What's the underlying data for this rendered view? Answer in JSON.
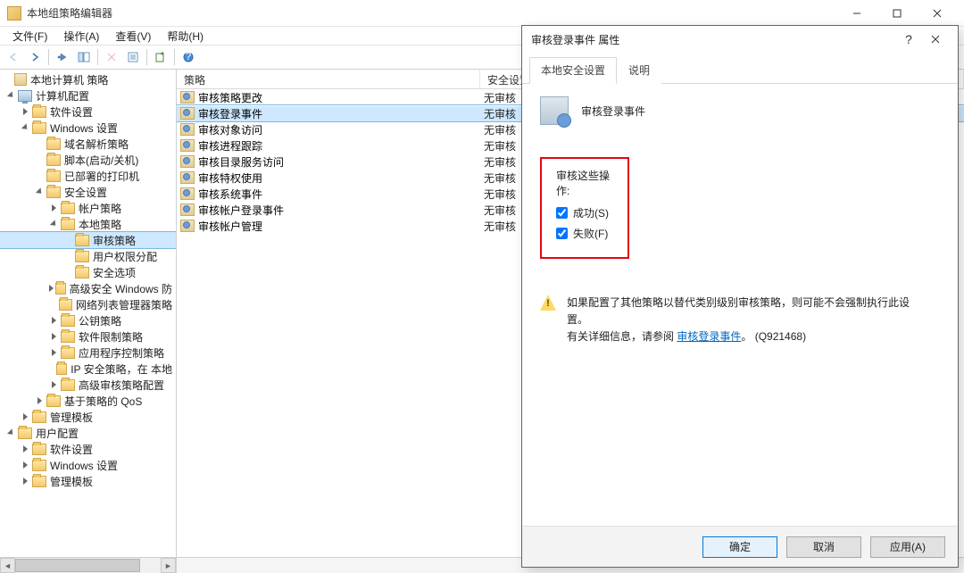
{
  "window": {
    "title": "本地组策略编辑器",
    "min_tip": "最小化",
    "max_tip": "最大化",
    "close_tip": "关闭"
  },
  "menu": {
    "file": "文件(F)",
    "action": "操作(A)",
    "view": "查看(V)",
    "help": "帮助(H)"
  },
  "tree": {
    "root": "本地计算机 策略",
    "computer_cfg": "计算机配置",
    "software_settings": "软件设置",
    "windows_settings": "Windows 设置",
    "dns_policy": "域名解析策略",
    "scripts": "脚本(启动/关机)",
    "deployed_printers": "已部署的打印机",
    "security_settings": "安全设置",
    "account_policy": "帐户策略",
    "local_policy": "本地策略",
    "audit_policy": "审核策略",
    "user_rights": "用户权限分配",
    "security_options": "安全选项",
    "adv_firewall": "高级安全 Windows 防",
    "net_list_mgr": "网络列表管理器策略",
    "pubkey_policy": "公钥策略",
    "software_restrict": "软件限制策略",
    "appctrl_policy": "应用程序控制策略",
    "ipsec_policy": "IP 安全策略，在 本地",
    "adv_audit_cfg": "高级审核策略配置",
    "qos": "基于策略的 QoS",
    "admin_templates_1": "管理模板",
    "user_cfg": "用户配置",
    "software_settings_2": "软件设置",
    "windows_settings_2": "Windows 设置",
    "admin_templates_2": "管理模板"
  },
  "list": {
    "col_policy": "策略",
    "col_setting": "安全设置",
    "rows": [
      {
        "name": "审核策略更改",
        "setting": "无审核"
      },
      {
        "name": "审核登录事件",
        "setting": "无审核"
      },
      {
        "name": "审核对象访问",
        "setting": "无审核"
      },
      {
        "name": "审核进程跟踪",
        "setting": "无审核"
      },
      {
        "name": "审核目录服务访问",
        "setting": "无审核"
      },
      {
        "name": "审核特权使用",
        "setting": "无审核"
      },
      {
        "name": "审核系统事件",
        "setting": "无审核"
      },
      {
        "name": "审核帐户登录事件",
        "setting": "无审核"
      },
      {
        "name": "审核帐户管理",
        "setting": "无审核"
      }
    ],
    "selected_index": 1
  },
  "dialog": {
    "title": "审核登录事件 属性",
    "tab_local": "本地安全设置",
    "tab_explain": "说明",
    "heading": "审核登录事件",
    "group_label": "审核这些操作:",
    "success": "成功(S)",
    "failure": "失败(F)",
    "note_line1": "如果配置了其他策略以替代类别级别审核策略，则可能不会强制执行此设置。",
    "note_line2_pre": "有关详细信息，请参阅",
    "note_link": "审核登录事件",
    "note_line2_post": "。 (Q921468)",
    "ok": "确定",
    "cancel": "取消",
    "apply": "应用(A)"
  }
}
